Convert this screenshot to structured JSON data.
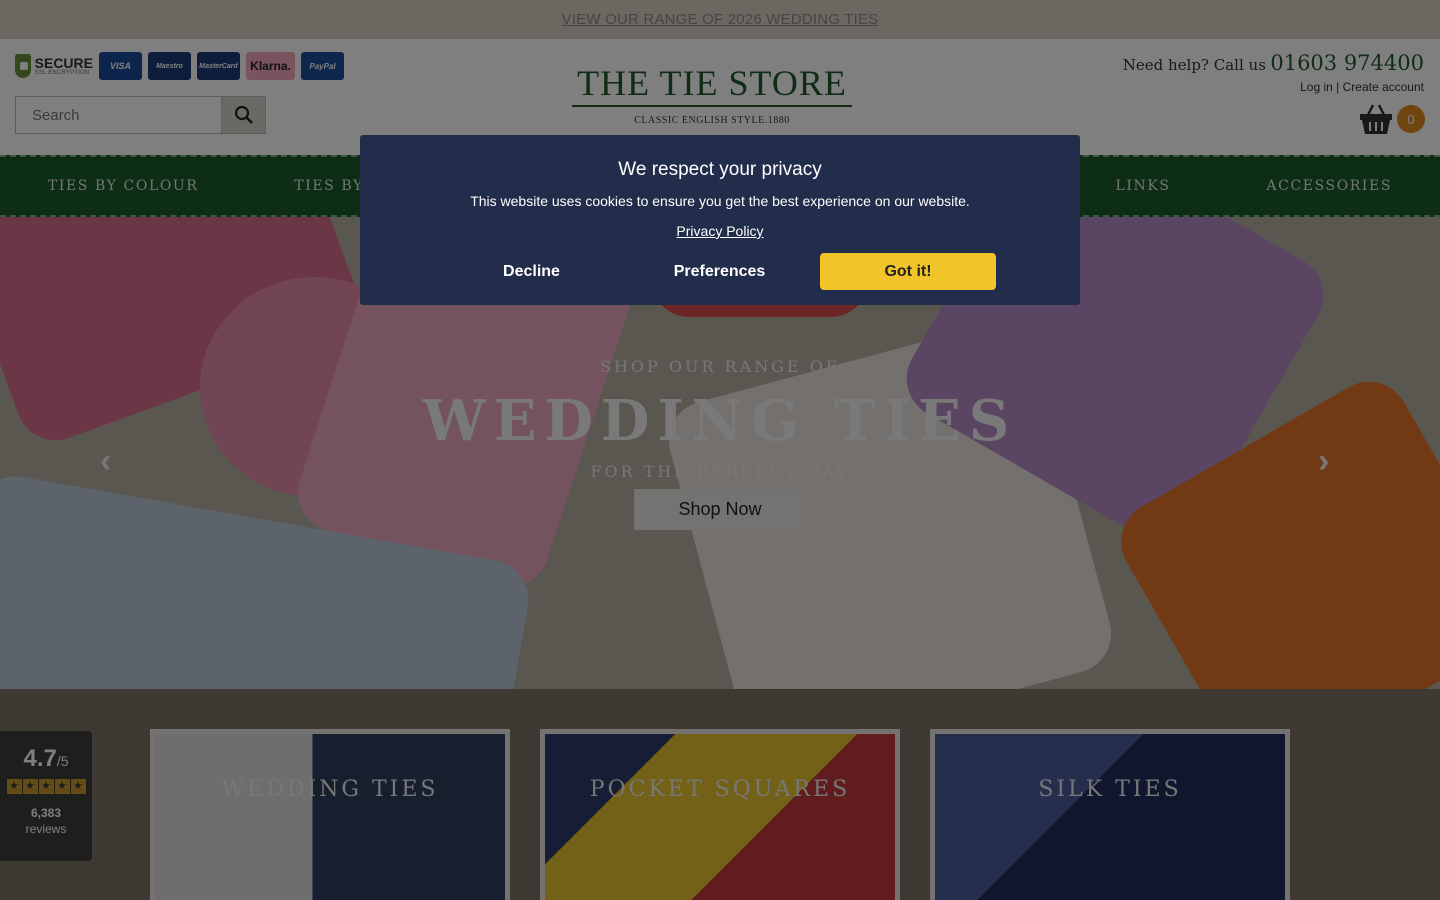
{
  "promo": {
    "text": "VIEW OUR RANGE OF 2026 WEDDING TIES"
  },
  "header": {
    "secure_label": "SECURE",
    "secure_sub": "SSL ENCRYPTION",
    "payment_cards": [
      "VISA",
      "Maestro",
      "MasterCard",
      "Klarna.",
      "PayPal"
    ],
    "search_placeholder": "Search",
    "logo_title": "THE TIE STORE",
    "logo_subtitle": "CLASSIC ENGLISH STYLE.1880",
    "help_text": "Need help? Call us",
    "phone": "01603 974400",
    "login": "Log in",
    "separator": "|",
    "create_account": "Create account",
    "basket_count": "0"
  },
  "nav": {
    "items": [
      "TIES BY COLOUR",
      "TIES BY",
      "LINKS",
      "ACCESSORIES"
    ]
  },
  "hero": {
    "kicker": "SHOP OUR RANGE OF",
    "title": "WEDDING TIES",
    "subtitle": "FOR THE PERFECT DAY",
    "cta": "Shop Now"
  },
  "categories": [
    {
      "label": "WEDDING TIES"
    },
    {
      "label": "POCKET SQUARES"
    },
    {
      "label": "SILK TIES"
    }
  ],
  "reviews": {
    "rating": "4.7",
    "out_of": "/5",
    "stars": 5,
    "count": "6,383",
    "label": "reviews"
  },
  "cookie": {
    "title": "We respect your privacy",
    "message": "This website uses cookies to ensure you get the best experience on our website.",
    "policy_link": "Privacy Policy",
    "decline": "Decline",
    "preferences": "Preferences",
    "accept": "Got it!"
  },
  "colors": {
    "nav_green": "#1a5a2a",
    "accept_yellow": "#f1c52a",
    "modal_bg": "#222d4b",
    "basket_orange": "#e08a1e"
  }
}
